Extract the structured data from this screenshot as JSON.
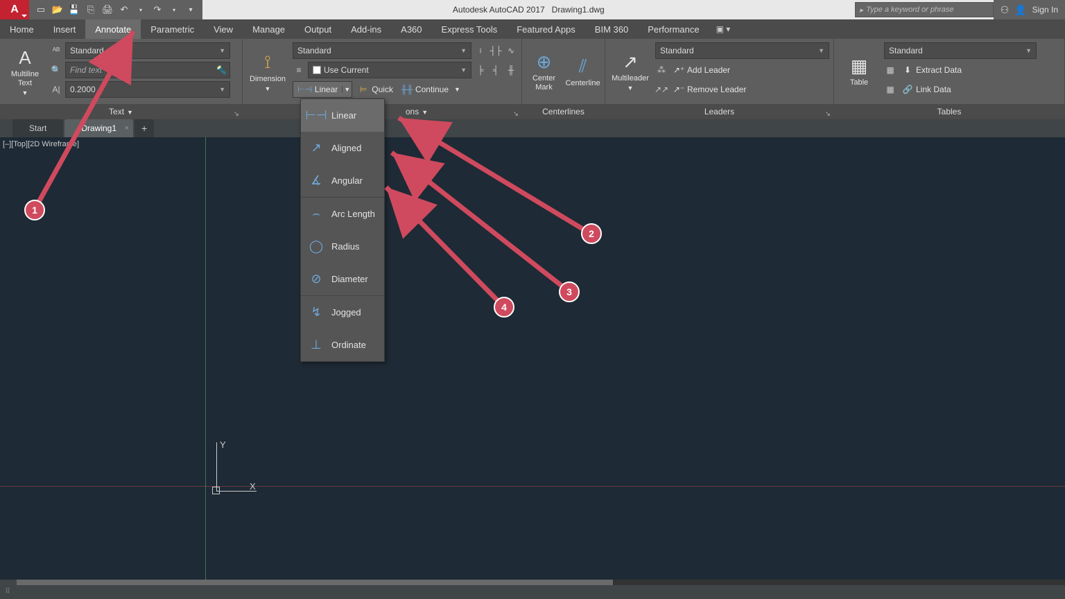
{
  "title": {
    "app": "Autodesk AutoCAD 2017",
    "doc": "Drawing1.dwg"
  },
  "search": {
    "placeholder": "Type a keyword or phrase"
  },
  "signin": "Sign In",
  "ribbon_tabs": [
    "Home",
    "Insert",
    "Annotate",
    "Parametric",
    "View",
    "Manage",
    "Output",
    "Add-ins",
    "A360",
    "Express Tools",
    "Featured Apps",
    "BIM 360",
    "Performance"
  ],
  "active_tab": "Annotate",
  "panels": {
    "text": {
      "title": "Text",
      "mtext": "Multiline\nText",
      "style": "Standard",
      "find_ph": "Find text",
      "height": "0.2000"
    },
    "dim": {
      "title": "Dimensions",
      "btn": "Dimension",
      "style": "Standard",
      "layer": "Use Current",
      "linear": "Linear",
      "quick": "Quick",
      "continue": "Continue",
      "dropdown": [
        "Linear",
        "Aligned",
        "Angular",
        "Arc Length",
        "Radius",
        "Diameter",
        "Jogged",
        "Ordinate"
      ]
    },
    "center": {
      "title": "Centerlines",
      "mark": "Center\nMark",
      "line": "Centerline"
    },
    "leaders": {
      "title": "Leaders",
      "ml": "Multileader",
      "style": "Standard",
      "add": "Add Leader",
      "remove": "Remove Leader"
    },
    "tables": {
      "title": "Tables",
      "tbl": "Table",
      "style": "Standard",
      "extract": "Extract Data",
      "link": "Link Data"
    }
  },
  "file_tabs": {
    "start": "Start",
    "doc": "Drawing1"
  },
  "view_label": "[–][Top][2D Wireframe]",
  "annotations": {
    "1": "1",
    "2": "2",
    "3": "3",
    "4": "4"
  }
}
